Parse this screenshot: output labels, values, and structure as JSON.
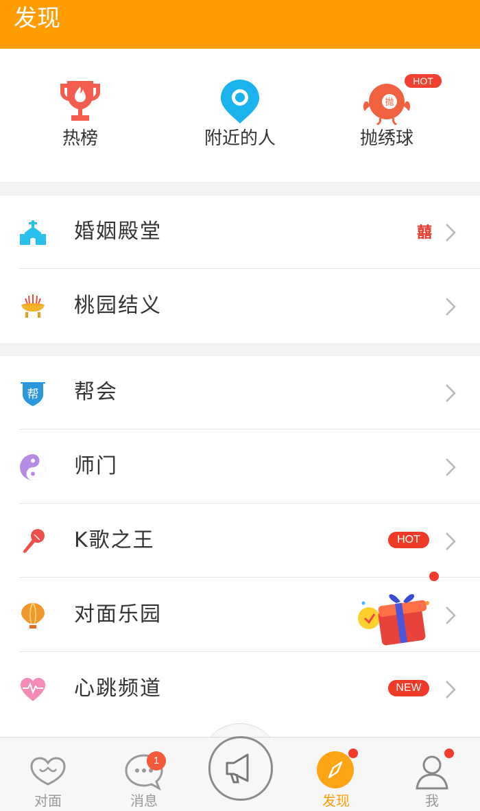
{
  "header": {
    "title": "发现"
  },
  "quick_actions": [
    {
      "label": "热榜",
      "icon": "trophy-icon"
    },
    {
      "label": "附近的人",
      "icon": "location-pin-icon"
    },
    {
      "label": "抛绣球",
      "icon": "embroidered-ball-icon",
      "badge": "HOT"
    }
  ],
  "group1": [
    {
      "label": "婚姻殿堂",
      "icon": "church-icon",
      "badge": "囍"
    },
    {
      "label": "桃园结义",
      "icon": "incense-burner-icon"
    }
  ],
  "group2": [
    {
      "label": "帮会",
      "icon": "gang-shield-icon",
      "icon_text": "帮"
    },
    {
      "label": "师门",
      "icon": "yin-yang-icon"
    },
    {
      "label": "K歌之王",
      "icon": "microphone-icon",
      "badge": "HOT"
    },
    {
      "label": "对面乐园",
      "icon": "hot-air-balloon-icon"
    },
    {
      "label": "心跳频道",
      "icon": "heartbeat-icon",
      "badge": "NEW"
    }
  ],
  "tabbar": {
    "tabs": [
      {
        "label": "对面",
        "icon": "heart-chat-icon"
      },
      {
        "label": "消息",
        "icon": "chat-bubble-icon",
        "badge": "1"
      },
      {
        "label": "",
        "icon": "megaphone-icon"
      },
      {
        "label": "发现",
        "icon": "compass-icon",
        "active": true
      },
      {
        "label": "我",
        "icon": "user-icon"
      }
    ]
  },
  "colors": {
    "accent": "#ff9d00",
    "badge_red": "#f03a28"
  }
}
